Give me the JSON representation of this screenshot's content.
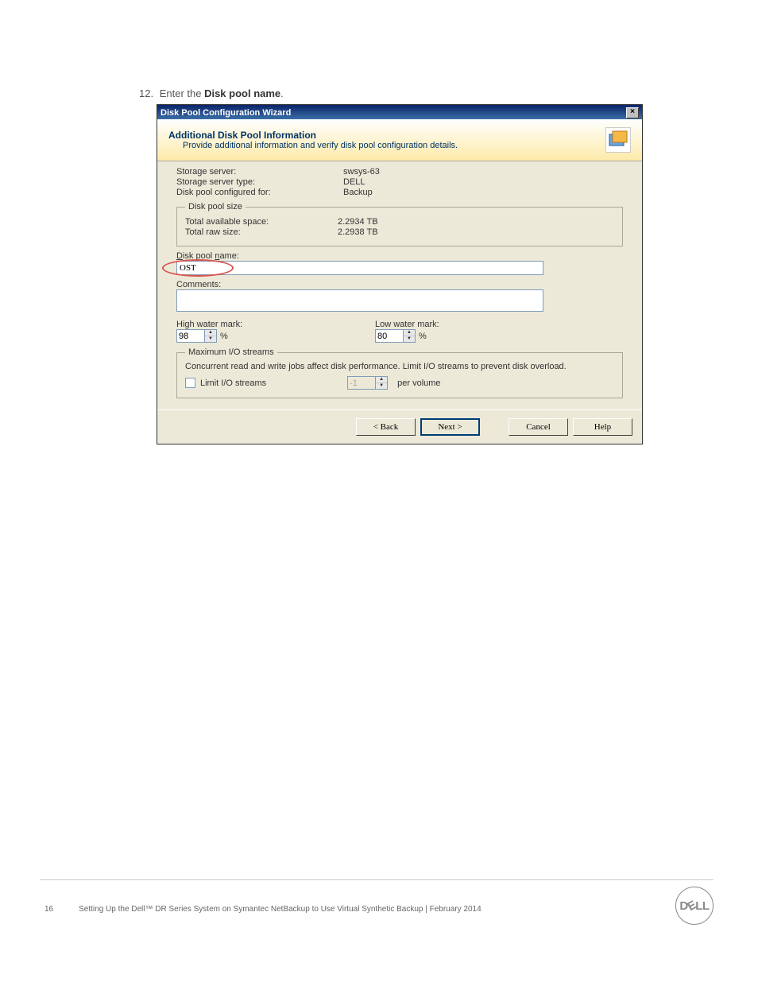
{
  "step": {
    "number": "12.",
    "prefix": "Enter the ",
    "bold": "Disk pool name",
    "suffix": "."
  },
  "wizard": {
    "title": "Disk Pool Configuration Wizard",
    "header": {
      "title": "Additional Disk Pool Information",
      "desc": "Provide additional information and verify disk pool configuration details."
    },
    "info": {
      "storage_server_label": "Storage server:",
      "storage_server_value": "swsys-63",
      "storage_server_type_label": "Storage server type:",
      "storage_server_type_value": "DELL",
      "disk_pool_configured_label": "Disk pool configured for:",
      "disk_pool_configured_value": "Backup"
    },
    "disk_pool_size": {
      "legend": "Disk pool size",
      "total_available_label": "Total available space:",
      "total_available_value": "2.2934 TB",
      "total_raw_label": "Total raw size:",
      "total_raw_value": "2.2938 TB"
    },
    "disk_pool_name": {
      "label": "Disk pool name:",
      "value": "OST"
    },
    "comments": {
      "label": "Comments:",
      "value": ""
    },
    "high_water": {
      "label": "High water mark:",
      "value": "98",
      "unit": "%"
    },
    "low_water": {
      "label": "Low water mark:",
      "value": "80",
      "unit": "%"
    },
    "max_io": {
      "legend": "Maximum I/O streams",
      "hint": "Concurrent read and write jobs affect disk performance. Limit I/O streams to prevent disk overload.",
      "checkbox_label": "Limit I/O streams",
      "value": "-1",
      "per_volume": "per volume"
    },
    "buttons": {
      "back": "< Back",
      "next": "Next >",
      "cancel": "Cancel",
      "help": "Help"
    },
    "close_glyph": "×"
  },
  "footer": {
    "page": "16",
    "text": "Setting Up the Dell™ DR Series System on Symantec NetBackup to Use Virtual Synthetic Backup | February 2014",
    "logo": "DELL"
  }
}
